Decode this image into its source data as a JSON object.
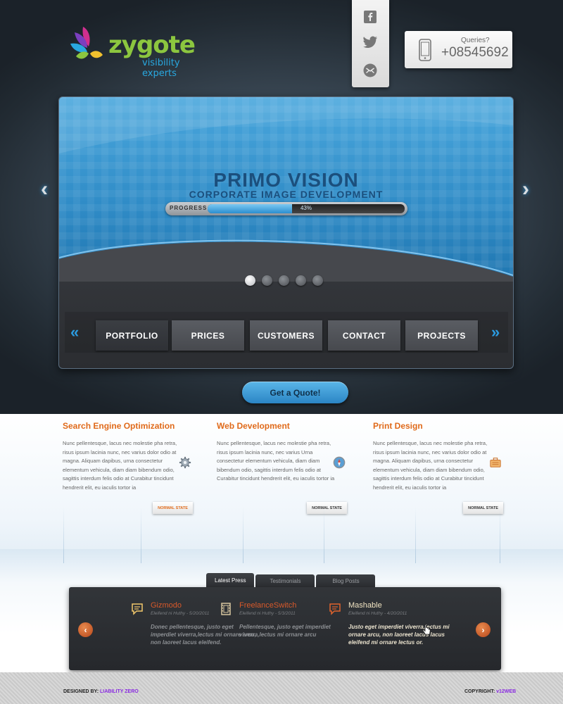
{
  "brand": {
    "name": "zygote",
    "tagline": "visibility experts"
  },
  "social": {
    "icons": [
      "facebook-icon",
      "twitter-icon",
      "email-icon"
    ]
  },
  "contact": {
    "label": "Queries?",
    "phone": "+08545692"
  },
  "slider": {
    "title": "PRIMO VISION",
    "subtitle": "CORPORATE IMAGE DEVELOPMENT",
    "progress_label": "PROGRESS",
    "progress_text": "43%",
    "progress_value": 0.43,
    "slide_count": 5,
    "active_slide": 1,
    "prev": "‹",
    "next": "›"
  },
  "nav": {
    "prev": "«",
    "next": "»",
    "items": [
      "PORTFOLIO",
      "PRICES",
      "CUSTOMERS",
      "CONTACT",
      "PROJECTS"
    ]
  },
  "cta": {
    "label": "Get a Quote!"
  },
  "services": [
    {
      "title": "Search Engine Optimization",
      "icon": "gear-icon",
      "text": "Nunc pellentesque, lacus nec molestie pha retra, risus ipsum lacinia nunc, nec varius dolor odio at magna. Aliquam dapibus, urna consectetur elementum vehicula, diam diam bibendum odio, sagittis interdum felis odio at Curabitur tincidunt hendrerit elit, eu iaculis tortor ia",
      "button": "NORMAL STATE"
    },
    {
      "title": "Web Development",
      "icon": "compass-icon",
      "text": "Nunc pellentesque, lacus nec molestie pha retra, risus ipsum lacinia nunc, nec varius Urna consectetur elementum vehicula, diam diam bibendum odio, sagittis interdum felis odio at Curabitur tincidunt hendrerit elit, eu iaculis tortor ia",
      "button": "NORMAL STATE"
    },
    {
      "title": "Print Design",
      "icon": "briefcase-icon",
      "text": "Nunc pellentesque, lacus nec molestie pha retra, risus ipsum lacinia nunc, nec varius dolor odio at magna. Aliquam dapibus, urna consectetur elementum vehicula, diam diam bibendum odio, sagittis interdum felis odio at Curabitur tincidunt hendrerit elit, eu iaculis tortor ia",
      "button": "NORMAL STATE"
    }
  ],
  "news": {
    "tabs": [
      "Latest Press",
      "Testimonials",
      "Blog Posts"
    ],
    "prev": "‹",
    "next": "›",
    "items": [
      {
        "title": "Gizmodo",
        "meta": "Eleifend ni Huthy - 5/20/2011",
        "icon": "speech-bubble-icon",
        "text": "Donec pellentesque, justo eget imperdiet viverra,lectus mi ornare arcu, non laoreet lacus eleifend."
      },
      {
        "title": "FreelanceSwitch",
        "meta": "Eleifend ni Huthy - 5/3/2011",
        "icon": "film-strip-icon",
        "text": "Pellentesque, justo eget imperdiet viverra,lectus mi ornare arcu"
      },
      {
        "title": "Mashable",
        "meta": "Eleifend ni Huthy - 4/20/2011",
        "icon": "speech-bubble-icon",
        "text": "Justo eget imperdiet viverra,lectus mi ornare arcu, non laoreet lacus lacus eleifend mi ornare lectus or."
      }
    ]
  },
  "footer": {
    "designed_label": "DESIGNED BY:",
    "designed_by": "LIABILITY ZERO",
    "copyright_label": "COPYRIGHT:",
    "copyright": "v12WEB"
  },
  "colors": {
    "accent_orange": "#e06a1a",
    "slider_blue": "#2f8bc6",
    "logo_green": "#8cc63f",
    "logo_blue": "#29a8e0"
  }
}
